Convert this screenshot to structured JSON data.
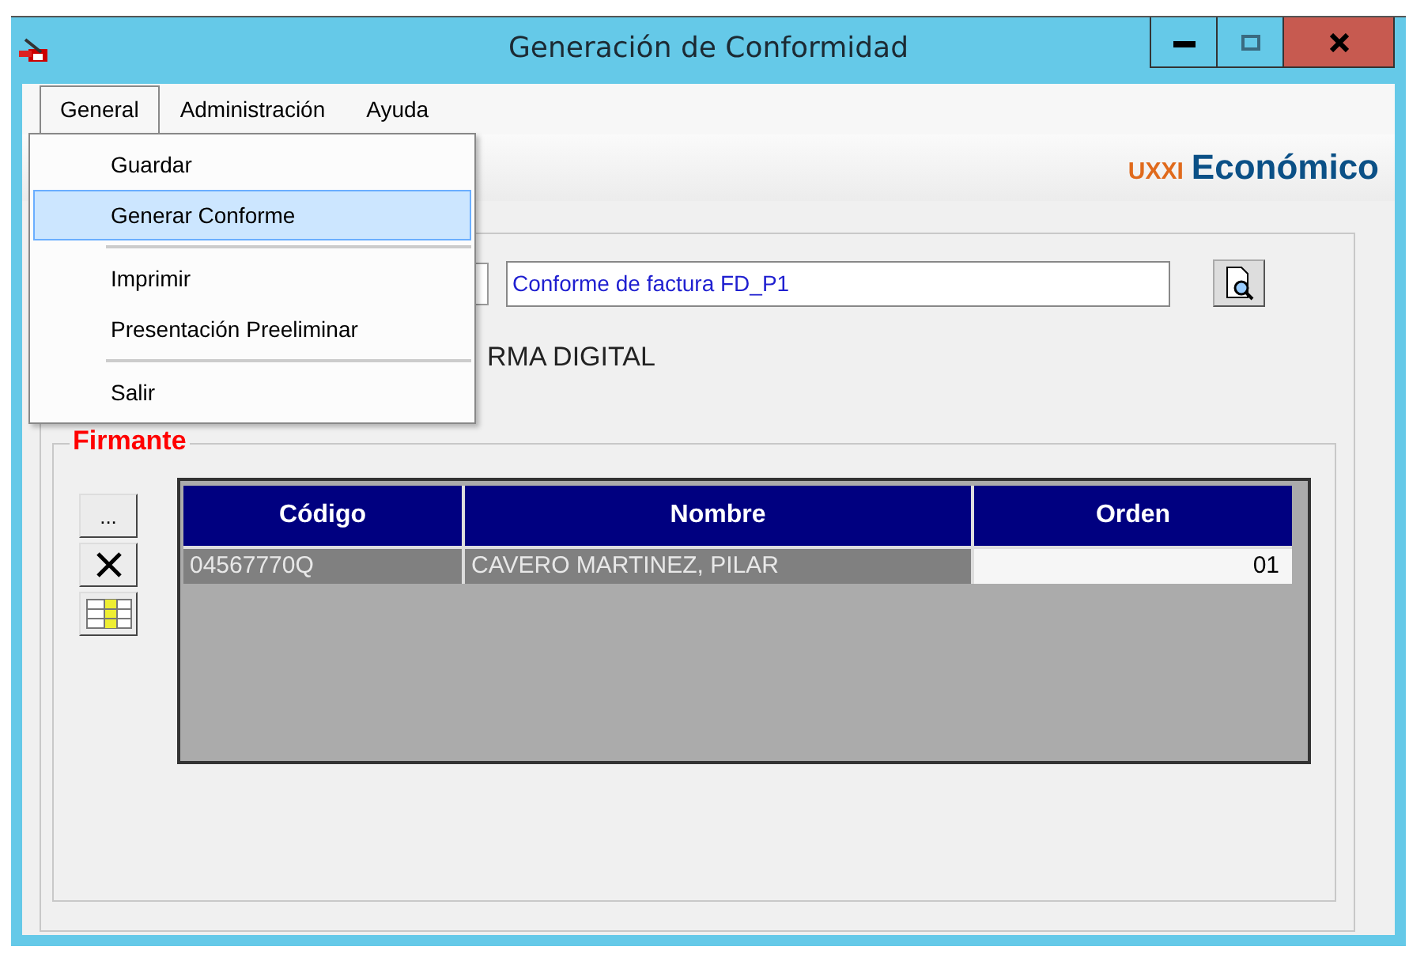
{
  "window": {
    "title": "Generación de Conformidad"
  },
  "menubar": [
    {
      "label": "General",
      "selected": true
    },
    {
      "label": "Administración",
      "selected": false
    },
    {
      "label": "Ayuda",
      "selected": false
    }
  ],
  "menu": [
    {
      "kind": "item",
      "label": "Guardar",
      "selected": false
    },
    {
      "kind": "item",
      "label": "Generar Conforme",
      "selected": true
    },
    {
      "kind": "separator"
    },
    {
      "kind": "item",
      "label": "Imprimir",
      "selected": false
    },
    {
      "kind": "item",
      "label": "Presentación Preeliminar",
      "selected": false
    },
    {
      "kind": "separator"
    },
    {
      "kind": "item",
      "label": "Salir",
      "selected": false
    }
  ],
  "logo": {
    "prefix": "UXXI",
    "name": "Económico"
  },
  "description_field": {
    "value": "Conforme de factura FD_P1"
  },
  "section_label": "RMA DIGITAL",
  "group": {
    "title": "Firmante",
    "table": {
      "columns": [
        "Código",
        "Nombre",
        "Orden"
      ],
      "rows": [
        {
          "selected": true,
          "cells": [
            {
              "text": "04567770Q",
              "focused": false
            },
            {
              "text": "CAVERO MARTINEZ, PILAR",
              "focused": false
            },
            {
              "text": "01",
              "focused": true
            }
          ]
        }
      ]
    },
    "buttons": [
      {
        "kind": "ellipsis",
        "label": "..."
      },
      {
        "kind": "delete"
      },
      {
        "kind": "grid"
      }
    ]
  }
}
